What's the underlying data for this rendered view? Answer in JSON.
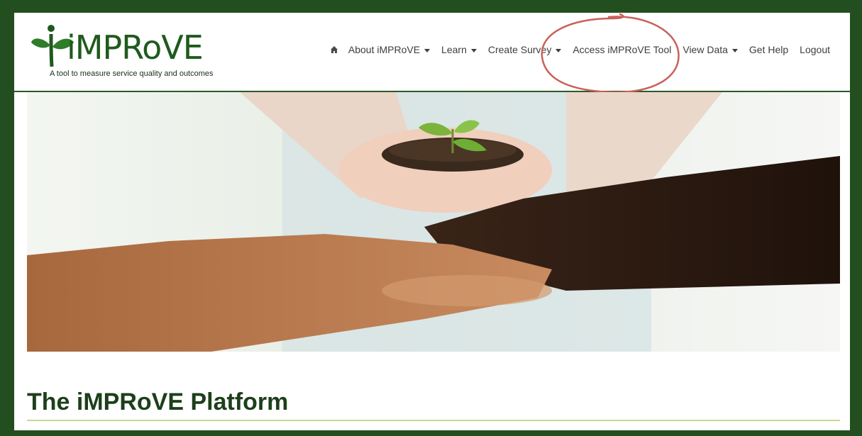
{
  "logo": {
    "wordmark": "iMPRoVE",
    "tagline": "A tool to measure service quality and outcomes"
  },
  "nav": {
    "home_icon": "home-icon",
    "items": [
      {
        "label": "About iMPRoVE",
        "dropdown": true
      },
      {
        "label": "Learn",
        "dropdown": true
      },
      {
        "label": "Create Survey",
        "dropdown": true
      },
      {
        "label": "Access iMPRoVE Tool",
        "dropdown": false,
        "highlighted": true
      },
      {
        "label": "View Data",
        "dropdown": true
      },
      {
        "label": "Get Help",
        "dropdown": false
      },
      {
        "label": "Logout",
        "dropdown": false
      }
    ]
  },
  "hero": {
    "image": "hands-holding-seedling-photo"
  },
  "main": {
    "title": "The iMPRoVE Platform"
  },
  "colors": {
    "frame": "#234f20",
    "brand_green": "#1f5a1d",
    "annotation": "#c8615a",
    "title_rule": "#c5d98a"
  }
}
